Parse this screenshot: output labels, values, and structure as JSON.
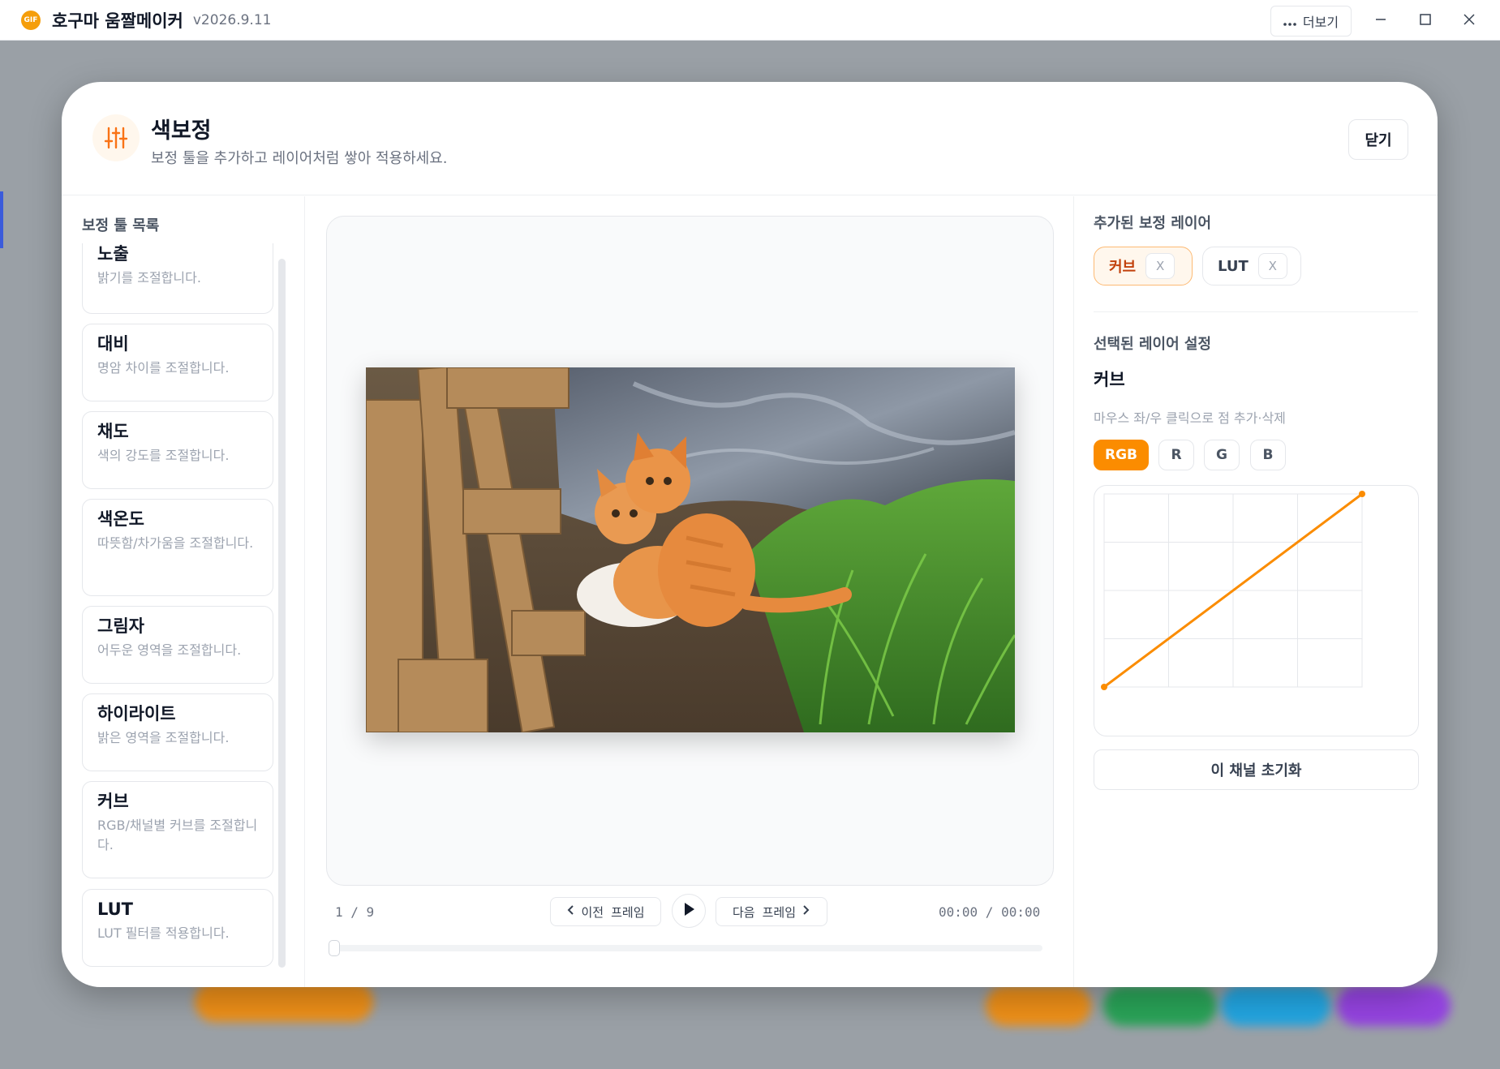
{
  "app": {
    "logo_text": "GIF",
    "title": "호구마 움짤메이커",
    "version": "v2026.9.11",
    "more_label": "더보기",
    "more_icon": "ellipsis-icon"
  },
  "modal": {
    "title": "색보정",
    "subtitle": "보정 툴을 추가하고 레이어처럼 쌓아 적용하세요.",
    "close_label": "닫기",
    "header_icon": "sliders-icon"
  },
  "tools": {
    "label": "보정 툴 목록",
    "items": [
      {
        "name": "노출",
        "desc": "밝기를 조절합니다."
      },
      {
        "name": "대비",
        "desc": "명암 차이를 조절합니다."
      },
      {
        "name": "채도",
        "desc": "색의 강도를 조절합니다."
      },
      {
        "name": "색온도",
        "desc": "따뜻함/차가움을 조절합니다."
      },
      {
        "name": "그림자",
        "desc": "어두운 영역을 조절합니다."
      },
      {
        "name": "하이라이트",
        "desc": "밝은 영역을 조절합니다."
      },
      {
        "name": "커브",
        "desc": "RGB/채널별 커브를 조절합니다."
      },
      {
        "name": "LUT",
        "desc": "LUT 필터를 적용합니다."
      }
    ]
  },
  "player": {
    "frame_counter": "1 / 9",
    "prev_label": "이전 프레임",
    "next_label": "다음 프레임",
    "time": "00:00 / 00:00",
    "progress": 0
  },
  "layers": {
    "label": "추가된 보정 레이어",
    "items": [
      {
        "name": "커브",
        "remove": "X",
        "active": true
      },
      {
        "name": "LUT",
        "remove": "X",
        "active": false
      }
    ]
  },
  "settings": {
    "label": "선택된 레이어 설정",
    "layer_name": "커브",
    "hint": "마우스 좌/우 클릭으로 점 추가·삭제",
    "channels": [
      "RGB",
      "R",
      "G",
      "B"
    ],
    "active_channel": "RGB",
    "curve_points": [
      [
        0,
        0
      ],
      [
        255,
        255
      ]
    ],
    "curve_color": "#fb8c00",
    "reset_label": "이 채널 초기화"
  }
}
